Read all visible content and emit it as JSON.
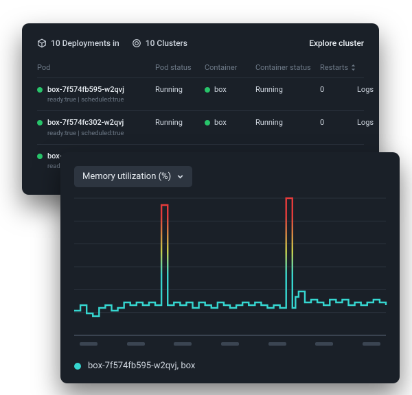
{
  "back": {
    "deployments_label": "10 Deployments in",
    "clusters_label": "10 Clusters",
    "explore_label": "Explore cluster",
    "columns": {
      "pod": "Pod",
      "pod_status": "Pod status",
      "container": "Container",
      "container_status": "Container status",
      "restarts": "Restarts",
      "action": "Logs"
    },
    "rows": [
      {
        "pod": "box-7f574fb595-w2qvj",
        "sub": "ready:true | scheduled:true",
        "pod_status": "Running",
        "container": "box",
        "container_status": "Running",
        "restarts": "0",
        "action": "Logs"
      },
      {
        "pod": "box-7f574fc302-w2qvj",
        "sub": "ready:true | scheduled:true",
        "pod_status": "Running",
        "container": "box",
        "container_status": "Running",
        "restarts": "0",
        "action": "Logs"
      },
      {
        "pod": "box-",
        "sub": "read",
        "pod_status": "",
        "container": "",
        "container_status": "",
        "restarts": "",
        "action": ""
      }
    ]
  },
  "front": {
    "dropdown_label": "Memory utilization (%)",
    "legend_label": "box-7f574fb595-w2qvj, box"
  },
  "chart_data": {
    "type": "line",
    "title": "Memory utilization (%)",
    "ylabel": "",
    "xlabel": "",
    "ylim": [
      0,
      100
    ],
    "grid_lines": [
      0,
      16.7,
      33.3,
      50,
      66.7,
      83.3,
      100
    ],
    "x_tick_count": 7,
    "series": [
      {
        "name": "box-7f574fb595-w2qvj, box",
        "color_low": "#36d6d0",
        "color_mid": "#c8cf4a",
        "color_high": "#e43b3b",
        "x": [
          0,
          2,
          4,
          6,
          8,
          10,
          12,
          14,
          16,
          18,
          20,
          22,
          24,
          26,
          27,
          28,
          29,
          30,
          32,
          34,
          36,
          38,
          40,
          42,
          44,
          46,
          48,
          50,
          52,
          54,
          56,
          58,
          60,
          62,
          64,
          66,
          67,
          68,
          69,
          70,
          71,
          72,
          74,
          76,
          78,
          80,
          82,
          84,
          86,
          88,
          90,
          92,
          94,
          96,
          98,
          100
        ],
        "values": [
          18,
          22,
          16,
          14,
          20,
          22,
          18,
          20,
          24,
          22,
          24,
          22,
          24,
          22,
          22,
          95,
          95,
          22,
          24,
          22,
          24,
          20,
          24,
          22,
          20,
          24,
          22,
          20,
          22,
          24,
          22,
          24,
          22,
          20,
          22,
          20,
          20,
          100,
          100,
          20,
          28,
          32,
          24,
          26,
          24,
          22,
          26,
          24,
          26,
          22,
          24,
          22,
          24,
          26,
          24,
          22
        ]
      }
    ]
  }
}
